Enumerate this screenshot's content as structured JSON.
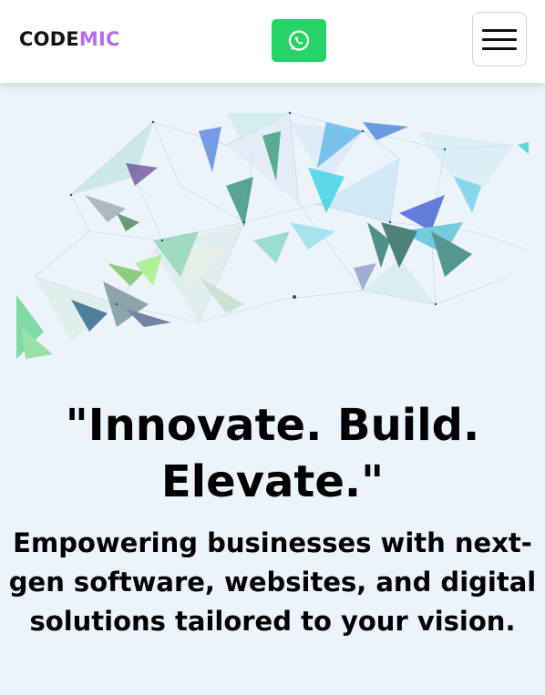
{
  "header": {
    "logo_part1": "CODE",
    "logo_part2": "MIC",
    "logo_accent_color": "#b56cf2",
    "whatsapp_icon": "whatsapp-icon",
    "whatsapp_color": "#25d366",
    "menu_icon": "hamburger-menu-icon"
  },
  "hero": {
    "graphic": "low-poly-network-illustration",
    "headline": "\"Innovate. Build. Elevate.\"",
    "subheadline": "Empowering businesses with next-gen software, websites, and digital solutions tailored to your vision."
  }
}
